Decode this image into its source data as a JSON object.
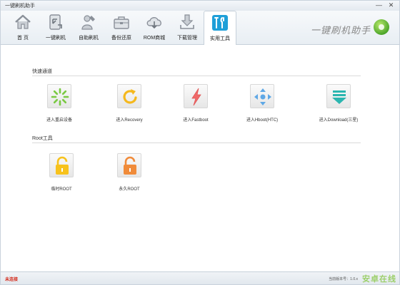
{
  "window": {
    "title": "一键刷机助手",
    "controls": {
      "minimize": "—",
      "close": "✕"
    }
  },
  "nav": [
    {
      "label": "首 页",
      "icon": "home-icon"
    },
    {
      "label": "一键刷机",
      "icon": "flash-phone-icon"
    },
    {
      "label": "自助刷机",
      "icon": "wrench-person-icon"
    },
    {
      "label": "备份还原",
      "icon": "toolbox-icon"
    },
    {
      "label": "ROM商城",
      "icon": "cloud-download-icon"
    },
    {
      "label": "下载管理",
      "icon": "download-tray-icon"
    },
    {
      "label": "实用工具",
      "icon": "tools-icon",
      "active": true
    }
  ],
  "brand": {
    "text": "一键刷机助手"
  },
  "sections": {
    "quick": {
      "title": "快速通道",
      "tools": [
        {
          "label": "进入重启设备",
          "icon": "loading-spinner-icon"
        },
        {
          "label": "进入Recovery",
          "icon": "refresh-arrow-icon"
        },
        {
          "label": "进入Fastboot",
          "icon": "lightning-icon"
        },
        {
          "label": "进入Hboot(HTC)",
          "icon": "dpad-arrows-icon"
        },
        {
          "label": "进入Download(三星)",
          "icon": "download-arrow-icon"
        }
      ]
    },
    "root": {
      "title": "Root工具",
      "tools": [
        {
          "label": "临时ROOT",
          "icon": "lock-yellow-icon"
        },
        {
          "label": "永久ROOT",
          "icon": "lock-orange-icon"
        }
      ]
    }
  },
  "status": {
    "connection": "未连接",
    "version": "当前版本号：1.0.x",
    "watermark": "安卓在线"
  },
  "colors": {
    "accent_red": "#d42a1a",
    "spinner_green": "#7ac943",
    "refresh_yellow": "#f5b81c",
    "lightning_red": "#f06a6a",
    "dpad_blue": "#5fa8e6",
    "download_teal": "#2bb6b0",
    "lock_yellow": "#f7c21c",
    "lock_orange": "#f08b3a"
  }
}
